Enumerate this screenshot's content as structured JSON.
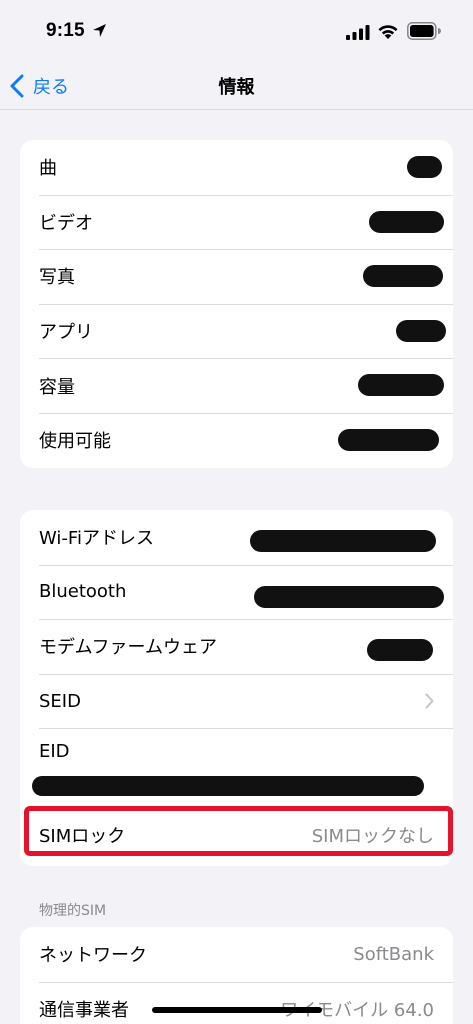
{
  "status_bar": {
    "time": "9:15"
  },
  "nav": {
    "back_label": "戻る",
    "title": "情報"
  },
  "group1": {
    "rows": [
      {
        "label": "曲"
      },
      {
        "label": "ビデオ"
      },
      {
        "label": "写真"
      },
      {
        "label": "アプリ"
      },
      {
        "label": "容量"
      },
      {
        "label": "使用可能"
      }
    ]
  },
  "group2": {
    "rows": [
      {
        "label": "Wi-Fiアドレス"
      },
      {
        "label": "Bluetooth"
      },
      {
        "label": "モデムファームウェア"
      },
      {
        "label": "SEID"
      },
      {
        "label": "EID"
      },
      {
        "label": "SIMロック",
        "value": "SIMロックなし"
      }
    ]
  },
  "physical_sim": {
    "header": "物理的SIM",
    "rows": [
      {
        "label": "ネットワーク",
        "value": "SoftBank"
      },
      {
        "label": "通信事業者",
        "value": "ワイモバイル 64.0"
      }
    ]
  },
  "colors": {
    "accent": "#0a7aff",
    "highlight": "#e3122d",
    "background": "#f2f2f7"
  }
}
